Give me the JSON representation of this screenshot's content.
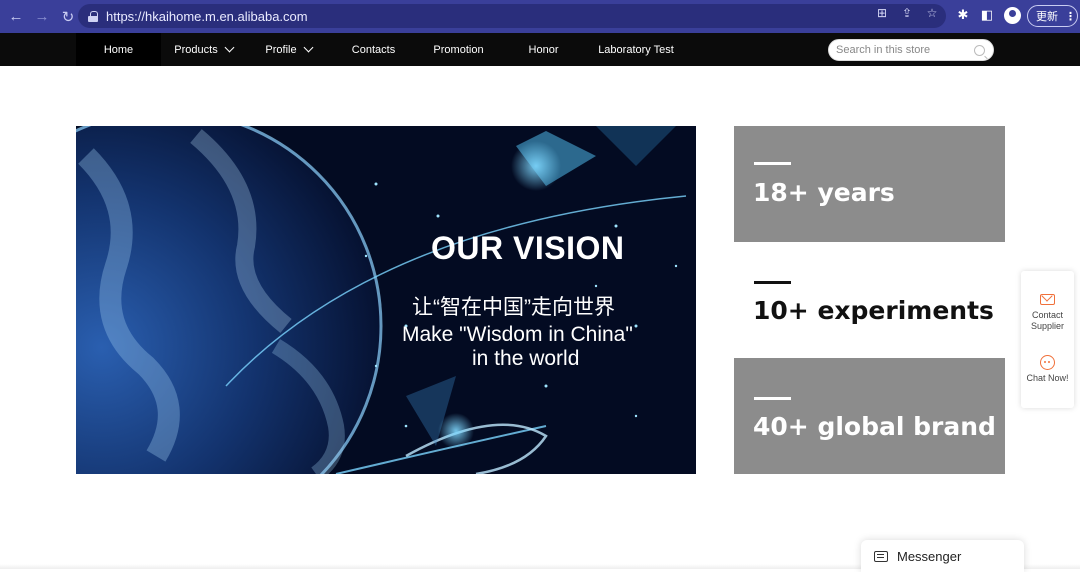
{
  "browser": {
    "url": "https://hkaihome.m.en.alibaba.com",
    "update_label": "更新",
    "menu_glyph": "⋮"
  },
  "nav": {
    "items": [
      {
        "label": "Home",
        "active": true,
        "dropdown": false
      },
      {
        "label": "Products",
        "active": false,
        "dropdown": true
      },
      {
        "label": "Profile",
        "active": false,
        "dropdown": true
      },
      {
        "label": "Contacts",
        "active": false,
        "dropdown": false
      },
      {
        "label": "Promotion",
        "active": false,
        "dropdown": false
      },
      {
        "label": "Honor",
        "active": false,
        "dropdown": false
      },
      {
        "label": "Laboratory Test",
        "active": false,
        "dropdown": false
      }
    ],
    "search_placeholder": "Search in this store"
  },
  "hero": {
    "title": "OUR VISION",
    "subtitle_cn": "让“智在中国”走向世界",
    "subtitle_en_line1": "Make \"Wisdom in China\"",
    "subtitle_en_line2": "in the world"
  },
  "stats": [
    {
      "text": "18+ years",
      "style": "gray"
    },
    {
      "text": "10+ experiments",
      "style": "white"
    },
    {
      "text": "40+ global brand",
      "style": "gray"
    }
  ],
  "side_panel": {
    "contact_line1": "Contact",
    "contact_line2": "Supplier",
    "chat": "Chat Now!"
  },
  "messenger": {
    "label": "Messenger"
  },
  "colors": {
    "accent": "#f0703a",
    "chrome": "#3a3f9a",
    "navbar": "#0b0b0b",
    "stat_gray": "#8c8c8c"
  }
}
